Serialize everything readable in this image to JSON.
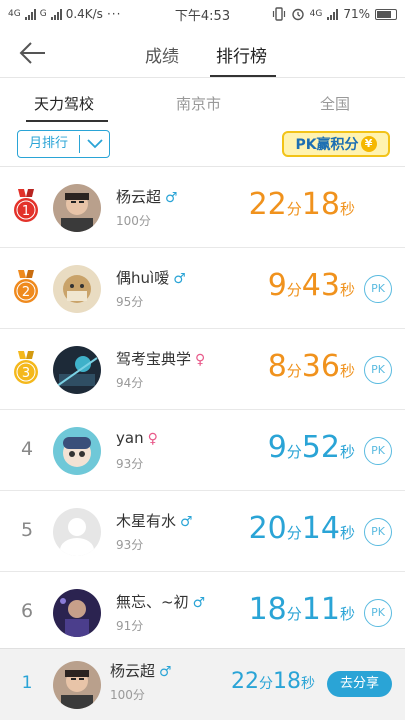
{
  "status_bar": {
    "left_text": "4G",
    "second_signal": "G",
    "speed": "0.4K/s",
    "dots": "···",
    "time": "下午4:53",
    "network": "4G",
    "battery": "71%"
  },
  "nav": {
    "tabs": [
      {
        "label": "成绩"
      },
      {
        "label": "排行榜"
      }
    ]
  },
  "scope": {
    "tabs": [
      {
        "label": "天力驾校"
      },
      {
        "label": "南京市"
      },
      {
        "label": "全国"
      }
    ]
  },
  "filter": {
    "selected": "月排行"
  },
  "banner": {
    "text": "PK赢积分"
  },
  "leaderboard": [
    {
      "rank": "1",
      "name": "杨云超",
      "gender": "♂",
      "score": "100分",
      "time_min": "22",
      "time_sec": "18",
      "unit_min": "分",
      "unit_sec": "秒",
      "pk": ""
    },
    {
      "rank": "2",
      "name": "偶huì嗳",
      "gender": "♂",
      "score": "95分",
      "time_min": "9",
      "time_sec": "43",
      "unit_min": "分",
      "unit_sec": "秒",
      "pk": "PK"
    },
    {
      "rank": "3",
      "name": "驾考宝典学",
      "gender": "♀",
      "score": "94分",
      "time_min": "8",
      "time_sec": "36",
      "unit_min": "分",
      "unit_sec": "秒",
      "pk": "PK"
    },
    {
      "rank": "4",
      "name": "yan",
      "gender": "♀",
      "score": "93分",
      "time_min": "9",
      "time_sec": "52",
      "unit_min": "分",
      "unit_sec": "秒",
      "pk": "PK"
    },
    {
      "rank": "5",
      "name": "木星有水",
      "gender": "♂",
      "score": "93分",
      "time_min": "20",
      "time_sec": "14",
      "unit_min": "分",
      "unit_sec": "秒",
      "pk": "PK"
    },
    {
      "rank": "6",
      "name": "無忘、~初",
      "gender": "♂",
      "score": "91分",
      "time_min": "18",
      "time_sec": "11",
      "unit_min": "分",
      "unit_sec": "秒",
      "pk": "PK"
    }
  ],
  "my_rank": {
    "rank": "1",
    "name": "杨云超",
    "gender": "♂",
    "score": "100分",
    "time_min": "22",
    "time_sec": "18",
    "unit_min": "分",
    "unit_sec": "秒",
    "share_label": "去分享"
  },
  "colors": {
    "accent": "#2aa4d6",
    "gold_time": "#f0921d",
    "medal_1": "#e3322a",
    "medal_2": "#ef8a1e",
    "medal_3": "#f4b81c"
  }
}
